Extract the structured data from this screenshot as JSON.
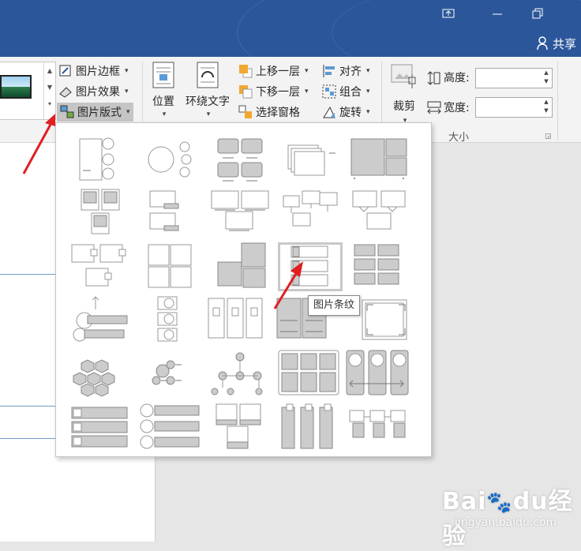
{
  "window": {
    "share_label": "共享",
    "icons": [
      "ribbon-display-icon",
      "minimize-icon",
      "restore-icon",
      "person-icon"
    ]
  },
  "ribbon": {
    "picture_border": "图片边框",
    "picture_effects": "图片效果",
    "picture_layout": "图片版式",
    "position": "位置",
    "wrap_text": "环绕文字",
    "bring_forward": "上移一层",
    "send_backward": "下移一层",
    "selection_pane": "选择窗格",
    "align": "对齐",
    "group": "组合",
    "rotate": "旋转",
    "crop": "裁剪",
    "height_label": "高度:",
    "width_label": "宽度:",
    "height_value": "",
    "width_value": "",
    "size_group": "大小"
  },
  "layouts": {
    "selected_index": 13,
    "tooltip": "图片条纹",
    "items": [
      "vertical-picture-circles",
      "circle-picture-hierarchy",
      "picture-grid",
      "stacked-pictures",
      "picture-frame-grid",
      "picture-caption-list",
      "offset-picture-blocks",
      "picture-accent-grid",
      "snapshot-picture-list",
      "bending-picture-caption",
      "picture-lineup-callouts",
      "four-picture-grid",
      "overlapping-picture-blocks",
      "picture-strips",
      "title-picture-blocks",
      "circular-picture-callout",
      "vertical-circle-list",
      "picture-columns",
      "picture-table",
      "picture-frames",
      "hexagon-cluster",
      "bubble-picture-list",
      "horizontal-picture-hierarchy",
      "picture-accent-blocks",
      "circle-picture-process",
      "picture-bullet-list",
      "circle-picture-list",
      "picture-caption-blocks",
      "picture-column-list",
      "picture-organization"
    ]
  },
  "watermark": {
    "brand": "Baidu经验",
    "url": "jingyan.baidu.com"
  }
}
